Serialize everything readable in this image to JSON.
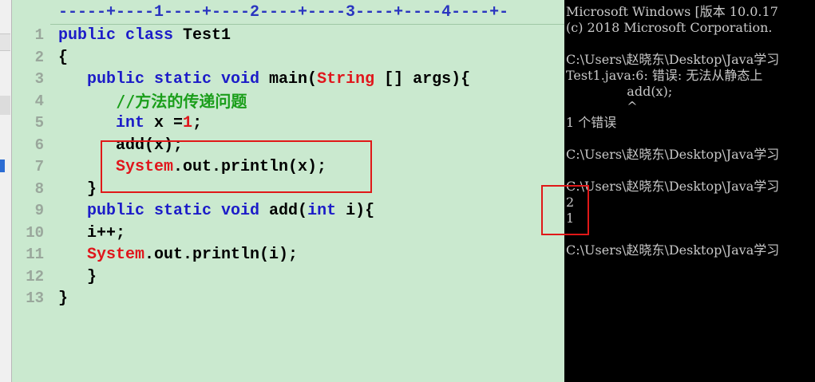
{
  "ruler": "-----+----1----+----2----+----3----+----4----+-",
  "editor": {
    "lines": [
      {
        "n": "1",
        "parts": [
          [
            "kw",
            "public class"
          ],
          [
            "plain",
            " Test1"
          ]
        ]
      },
      {
        "n": "2",
        "parts": [
          [
            "plain",
            "{"
          ]
        ]
      },
      {
        "n": "3",
        "parts": [
          [
            "kw",
            "   public static void"
          ],
          [
            "plain",
            " main("
          ],
          [
            "str",
            "String"
          ],
          [
            "plain",
            " [] args){"
          ]
        ]
      },
      {
        "n": "4",
        "parts": [
          [
            "cm",
            "      //方法的传递问题"
          ]
        ]
      },
      {
        "n": "5",
        "parts": [
          [
            "kw",
            "      int"
          ],
          [
            "plain",
            " x ="
          ],
          [
            "num",
            "1"
          ],
          [
            "plain",
            ";"
          ]
        ]
      },
      {
        "n": "6",
        "parts": [
          [
            "plain",
            "      add(x);"
          ]
        ]
      },
      {
        "n": "7",
        "parts": [
          [
            "str",
            "      System"
          ],
          [
            "plain",
            ".out.println(x);"
          ]
        ]
      },
      {
        "n": "8",
        "parts": [
          [
            "plain",
            "   }"
          ]
        ]
      },
      {
        "n": "9",
        "parts": [
          [
            "kw",
            "   public static void"
          ],
          [
            "plain",
            " add("
          ],
          [
            "kw",
            "int"
          ],
          [
            "plain",
            " i){"
          ]
        ]
      },
      {
        "n": "10",
        "parts": [
          [
            "plain",
            "   i++;"
          ]
        ]
      },
      {
        "n": "11",
        "parts": [
          [
            "str",
            "   System"
          ],
          [
            "plain",
            ".out.println(i);"
          ]
        ]
      },
      {
        "n": "12",
        "parts": [
          [
            "plain",
            "   }"
          ]
        ]
      },
      {
        "n": "13",
        "parts": [
          [
            "plain",
            "}"
          ]
        ]
      }
    ]
  },
  "console": {
    "lines": [
      "Microsoft Windows [版本 10.0.17",
      "(c) 2018 Microsoft Corporation.",
      "",
      "C:\\Users\\赵晓东\\Desktop\\Java学习",
      "Test1.java:6: 错误: 无法从静态上",
      "               add(x);",
      "               ^",
      "1 个错误",
      "",
      "C:\\Users\\赵晓东\\Desktop\\Java学习",
      "",
      "C:\\Users\\赵晓东\\Desktop\\Java学习",
      "2",
      "1",
      "",
      "C:\\Users\\赵晓东\\Desktop\\Java学习"
    ]
  },
  "colors": {
    "editor_bg": "#cae9cf",
    "keyword": "#1c1cc8",
    "string_type": "#e0161c",
    "comment": "#1a9e1a",
    "highlight_box": "#e01818",
    "console_bg": "#000000",
    "console_text": "#c8c8c8"
  }
}
